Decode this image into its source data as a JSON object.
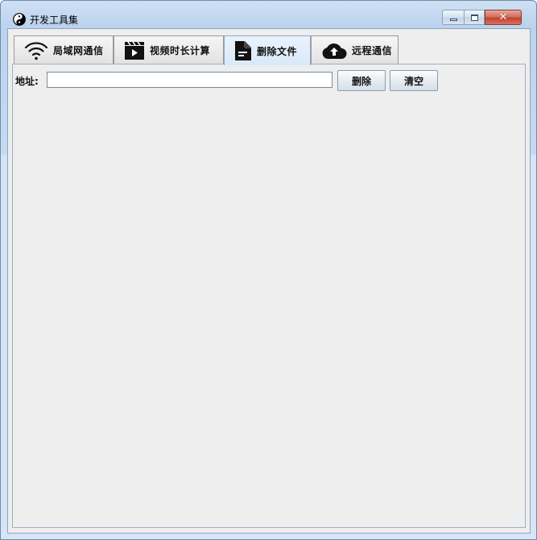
{
  "window": {
    "title": "开发工具集",
    "app_icon": "yin-yang-icon",
    "controls": [
      "minimize-icon",
      "maximize-icon",
      "close-icon"
    ]
  },
  "tabs": [
    {
      "label": "局域网通信",
      "icon": "wifi-icon",
      "active": false
    },
    {
      "label": "视频时长计算",
      "icon": "video-clapper-icon",
      "active": false
    },
    {
      "label": "删除文件",
      "icon": "file-icon",
      "active": true
    },
    {
      "label": "远程通信",
      "icon": "cloud-upload-icon",
      "active": false
    }
  ],
  "delete_panel": {
    "address_label": "地址:",
    "address_value": "",
    "delete_button": "删除",
    "clear_button": "清空"
  }
}
